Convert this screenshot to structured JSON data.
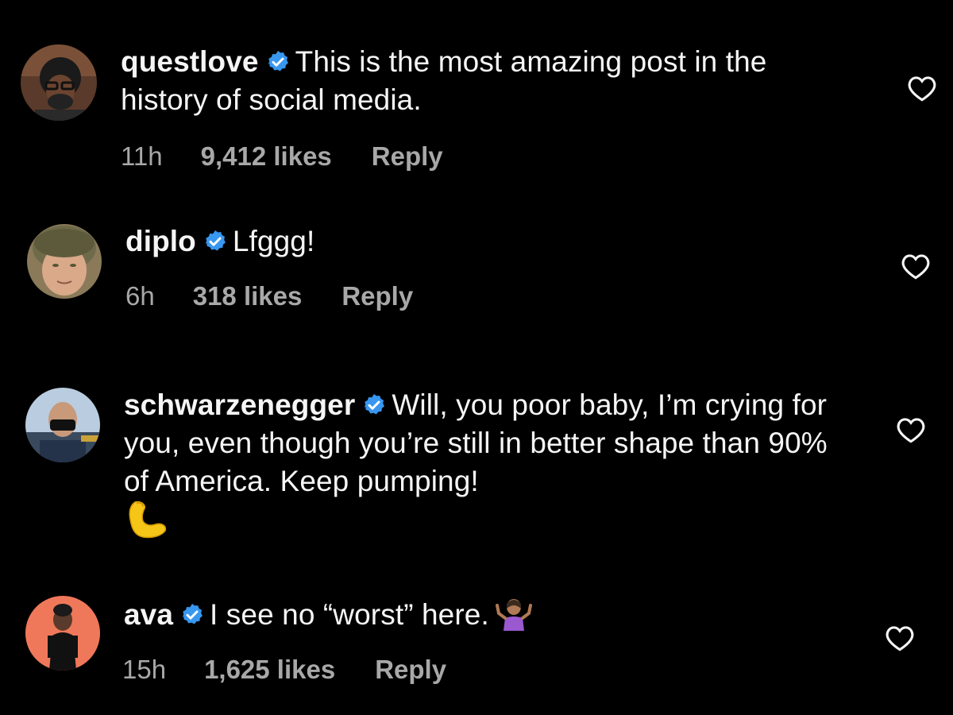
{
  "colors": {
    "background": "#000000",
    "text": "#f5f5f5",
    "meta": "#a8a8a8",
    "verified": "#3897f0"
  },
  "comments": [
    {
      "username": "questlove",
      "verified": true,
      "text": "This is the most amazing post in the history of social media.",
      "time": "11h",
      "likes": "9,412 likes",
      "reply": "Reply",
      "avatar_icon": "questlove-avatar"
    },
    {
      "username": "diplo",
      "verified": true,
      "text": "Lfggg!",
      "time": "6h",
      "likes": "318 likes",
      "reply": "Reply",
      "avatar_icon": "diplo-avatar"
    },
    {
      "username": "schwarzenegger",
      "verified": true,
      "text": "Will, you poor baby, I’m crying for you, even though you’re still in better shape than 90% of America. Keep pumping!",
      "emoji": "flexed-biceps-emoji",
      "avatar_icon": "schwarzenegger-avatar"
    },
    {
      "username": "ava",
      "verified": true,
      "text": "I see no “worst” here.",
      "emoji": "person-shrugging-emoji",
      "time": "15h",
      "likes": "1,625 likes",
      "reply": "Reply",
      "avatar_icon": "ava-avatar"
    }
  ]
}
